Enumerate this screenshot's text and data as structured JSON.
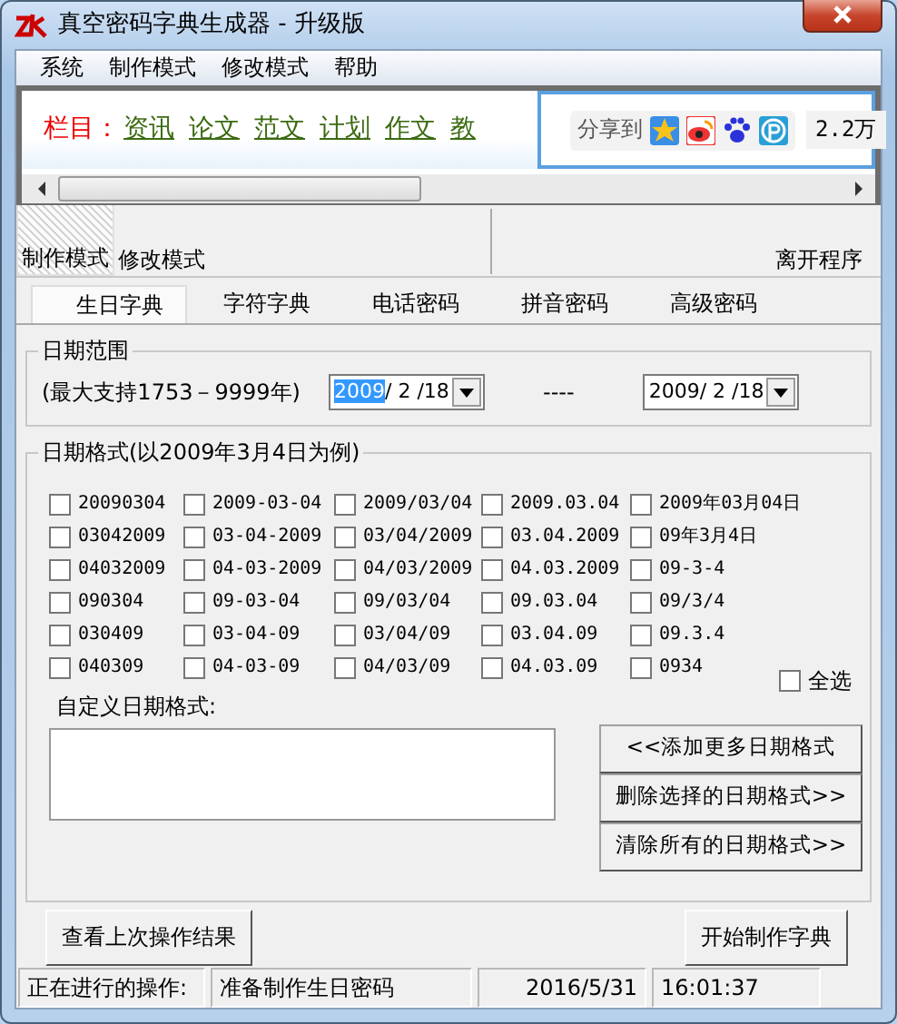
{
  "window": {
    "title": "真空密码字典生成器 - 升级版"
  },
  "menu": [
    "系统",
    "制作模式",
    "修改模式",
    "帮助"
  ],
  "banner": {
    "label": "栏目：",
    "links": [
      "资讯",
      "论文",
      "范文",
      "计划",
      "作文",
      "教"
    ],
    "share": {
      "label": "分享到",
      "count": "2.2万"
    }
  },
  "toolbar": {
    "buttons": [
      {
        "label": "制作模式",
        "selected": true
      },
      {
        "label": "修改模式",
        "selected": false
      }
    ],
    "exit": "离开程序"
  },
  "tabs": [
    {
      "label": "生日字典",
      "selected": true
    },
    {
      "label": "字符字典",
      "selected": false
    },
    {
      "label": "电话密码",
      "selected": false
    },
    {
      "label": "拼音密码",
      "selected": false
    },
    {
      "label": "高级密码",
      "selected": false
    }
  ],
  "date_range": {
    "title": "日期范围",
    "note": "(最大支持1753－9999年)",
    "start": {
      "highlighted": "2009",
      "rest": "/ 2 /18"
    },
    "separator": "----",
    "end": "2009/ 2 /18"
  },
  "date_format": {
    "title": "日期格式(以2009年3月4日为例)",
    "formats": [
      {
        "label": "20090304",
        "checked": false
      },
      {
        "label": "2009-03-04",
        "checked": false
      },
      {
        "label": "2009/03/04",
        "checked": false
      },
      {
        "label": "2009.03.04",
        "checked": false
      },
      {
        "label": "2009年03月04日",
        "checked": false
      },
      {
        "label": "03042009",
        "checked": false
      },
      {
        "label": "03-04-2009",
        "checked": false
      },
      {
        "label": "03/04/2009",
        "checked": false
      },
      {
        "label": "03.04.2009",
        "checked": false
      },
      {
        "label": "09年3月4日",
        "checked": false
      },
      {
        "label": "04032009",
        "checked": false
      },
      {
        "label": "04-03-2009",
        "checked": false
      },
      {
        "label": "04/03/2009",
        "checked": false
      },
      {
        "label": "04.03.2009",
        "checked": false
      },
      {
        "label": "09-3-4",
        "checked": false
      },
      {
        "label": "090304",
        "checked": false
      },
      {
        "label": "09-03-04",
        "checked": false
      },
      {
        "label": "09/03/04",
        "checked": false
      },
      {
        "label": "09.03.04",
        "checked": false
      },
      {
        "label": "09/3/4",
        "checked": false
      },
      {
        "label": "030409",
        "checked": false
      },
      {
        "label": "03-04-09",
        "checked": false
      },
      {
        "label": "03/04/09",
        "checked": false
      },
      {
        "label": "03.04.09",
        "checked": false
      },
      {
        "label": "09.3.4",
        "checked": false
      },
      {
        "label": "040309",
        "checked": false
      },
      {
        "label": "04-03-09",
        "checked": false
      },
      {
        "label": "04/03/09",
        "checked": false
      },
      {
        "label": "04.03.09",
        "checked": false
      },
      {
        "label": "0934",
        "checked": false
      }
    ],
    "select_all": {
      "label": "全选",
      "checked": false
    },
    "custom_label": "自定义日期格式:",
    "buttons": [
      "<<添加更多日期格式",
      "删除选择的日期格式>>",
      "清除所有的日期格式>>"
    ]
  },
  "bottom_buttons": [
    "查看上次操作结果",
    "开始制作字典"
  ],
  "status_bar": [
    "正在进行的操作:",
    "准备制作生日密码",
    "2016/5/31",
    "16:01:37"
  ]
}
